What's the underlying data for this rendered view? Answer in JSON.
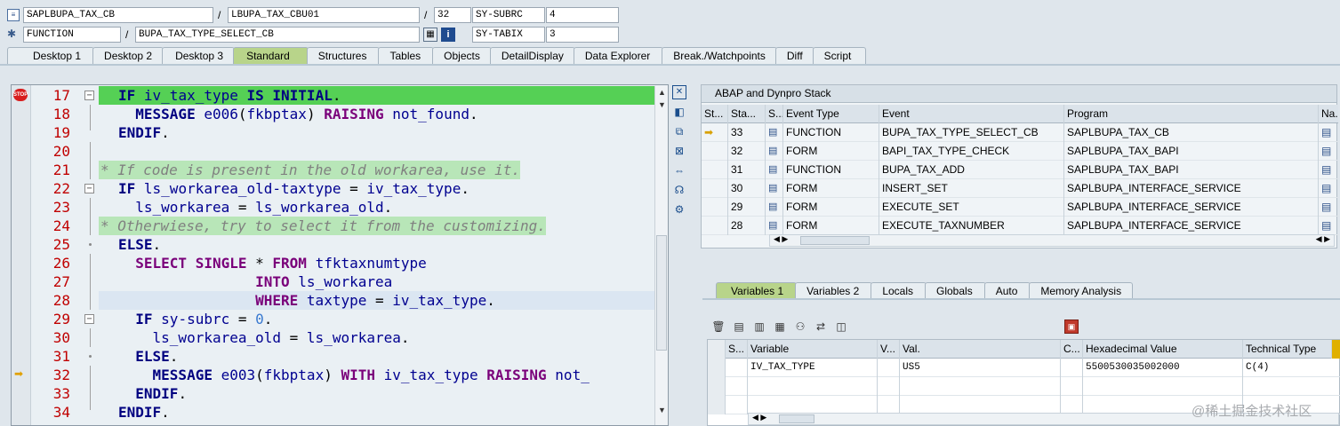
{
  "header": {
    "program": "SAPLBUPA_TAX_CB",
    "include": "LBUPA_TAX_CBU01",
    "line": "32",
    "sysvar1": "SY-SUBRC",
    "sysval1": "4",
    "event_type": "FUNCTION",
    "event": "BUPA_TAX_TYPE_SELECT_CB",
    "sysvar2": "SY-TABIX",
    "sysval2": "3"
  },
  "tabs": [
    "Desktop 1",
    "Desktop 2",
    "Desktop 3",
    "Standard",
    "Structures",
    "Tables",
    "Objects",
    "DetailDisplay",
    "Data Explorer",
    "Break./Watchpoints",
    "Diff",
    "Script"
  ],
  "editor": {
    "line_numbers": [
      "17",
      "18",
      "19",
      "20",
      "21",
      "22",
      "23",
      "24",
      "25",
      "26",
      "27",
      "28",
      "29",
      "30",
      "31",
      "32",
      "33",
      "34"
    ],
    "lines": [
      {
        "parts": [
          {
            "t": "IF ",
            "c": "kw"
          },
          {
            "t": "iv_tax_type ",
            "c": "id"
          },
          {
            "t": "IS INITIAL",
            "c": "kw"
          },
          {
            "t": ".",
            "c": ""
          }
        ]
      },
      {
        "parts": [
          {
            "t": "  MESSAGE ",
            "c": "kw"
          },
          {
            "t": "e006",
            "c": "id"
          },
          {
            "t": "(",
            "c": ""
          },
          {
            "t": "fkbptax",
            "c": "id"
          },
          {
            "t": ") ",
            "c": ""
          },
          {
            "t": "RAISING ",
            "c": "kw2"
          },
          {
            "t": "not_found",
            "c": "id"
          },
          {
            "t": ".",
            "c": ""
          }
        ]
      },
      {
        "parts": [
          {
            "t": "ENDIF",
            "c": "kw"
          },
          {
            "t": ".",
            "c": ""
          }
        ]
      },
      {
        "parts": []
      },
      {
        "parts": [
          {
            "t": "* If code is present in the old workarea, use it.",
            "c": "cmt"
          }
        ]
      },
      {
        "parts": [
          {
            "t": "IF ",
            "c": "kw"
          },
          {
            "t": "ls_workarea_old-taxtype ",
            "c": "id"
          },
          {
            "t": "= ",
            "c": ""
          },
          {
            "t": "iv_tax_type",
            "c": "id"
          },
          {
            "t": ".",
            "c": ""
          }
        ]
      },
      {
        "parts": [
          {
            "t": "  ls_workarea ",
            "c": "id"
          },
          {
            "t": "= ",
            "c": ""
          },
          {
            "t": "ls_workarea_old",
            "c": "id"
          },
          {
            "t": ".",
            "c": ""
          }
        ]
      },
      {
        "parts": [
          {
            "t": "* Otherwiese, try to select it from the customizing.",
            "c": "cmt"
          }
        ]
      },
      {
        "parts": [
          {
            "t": "ELSE",
            "c": "kw"
          },
          {
            "t": ".",
            "c": ""
          }
        ]
      },
      {
        "parts": [
          {
            "t": "  SELECT SINGLE ",
            "c": "kw2"
          },
          {
            "t": "* ",
            "c": ""
          },
          {
            "t": "FROM ",
            "c": "kw2"
          },
          {
            "t": "tfktaxnumtype",
            "c": "id"
          }
        ]
      },
      {
        "parts": [
          {
            "t": "                INTO ",
            "c": "kw2"
          },
          {
            "t": "ls_workarea",
            "c": "id"
          }
        ]
      },
      {
        "parts": [
          {
            "t": "                WHERE ",
            "c": "kw2"
          },
          {
            "t": "taxtype ",
            "c": "id"
          },
          {
            "t": "= ",
            "c": ""
          },
          {
            "t": "iv_tax_type",
            "c": "id"
          },
          {
            "t": ".",
            "c": ""
          }
        ]
      },
      {
        "parts": [
          {
            "t": "  IF ",
            "c": "kw"
          },
          {
            "t": "sy-subrc ",
            "c": "id"
          },
          {
            "t": "= ",
            "c": ""
          },
          {
            "t": "0",
            "c": "num"
          },
          {
            "t": ".",
            "c": ""
          }
        ]
      },
      {
        "parts": [
          {
            "t": "    ls_workarea_old ",
            "c": "id"
          },
          {
            "t": "= ",
            "c": ""
          },
          {
            "t": "ls_workarea",
            "c": "id"
          },
          {
            "t": ".",
            "c": ""
          }
        ]
      },
      {
        "parts": [
          {
            "t": "  ELSE",
            "c": "kw"
          },
          {
            "t": ".",
            "c": ""
          }
        ]
      },
      {
        "parts": [
          {
            "t": "    MESSAGE ",
            "c": "kw"
          },
          {
            "t": "e003",
            "c": "id"
          },
          {
            "t": "(",
            "c": ""
          },
          {
            "t": "fkbptax",
            "c": "id"
          },
          {
            "t": ") ",
            "c": ""
          },
          {
            "t": "WITH ",
            "c": "kw2"
          },
          {
            "t": "iv_tax_type ",
            "c": "id"
          },
          {
            "t": "RAISING ",
            "c": "kw2"
          },
          {
            "t": "not_",
            "c": "id"
          }
        ]
      },
      {
        "parts": [
          {
            "t": "  ENDIF",
            "c": "kw"
          },
          {
            "t": ".",
            "c": ""
          }
        ]
      },
      {
        "parts": [
          {
            "t": "ENDIF",
            "c": "kw"
          },
          {
            "t": ".",
            "c": ""
          }
        ]
      }
    ]
  },
  "stack": {
    "title": "ABAP and Dynpro Stack",
    "columns": [
      "St...",
      "Sta...",
      "S...",
      "Event Type",
      "Event",
      "Program",
      "Na..."
    ],
    "rows": [
      {
        "level": "33",
        "type": "FUNCTION",
        "event": "BUPA_TAX_TYPE_SELECT_CB",
        "program": "SAPLBUPA_TAX_CB",
        "current": true
      },
      {
        "level": "32",
        "type": "FORM",
        "event": "BAPI_TAX_TYPE_CHECK",
        "program": "SAPLBUPA_TAX_BAPI",
        "current": false
      },
      {
        "level": "31",
        "type": "FUNCTION",
        "event": "BUPA_TAX_ADD",
        "program": "SAPLBUPA_TAX_BAPI",
        "current": false
      },
      {
        "level": "30",
        "type": "FORM",
        "event": "INSERT_SET",
        "program": "SAPLBUPA_INTERFACE_SERVICE",
        "current": false
      },
      {
        "level": "29",
        "type": "FORM",
        "event": "EXECUTE_SET",
        "program": "SAPLBUPA_INTERFACE_SERVICE",
        "current": false
      },
      {
        "level": "28",
        "type": "FORM",
        "event": "EXECUTE_TAXNUMBER",
        "program": "SAPLBUPA_INTERFACE_SERVICE",
        "current": false
      }
    ]
  },
  "var_tabs": [
    "Variables 1",
    "Variables 2",
    "Locals",
    "Globals",
    "Auto",
    "Memory Analysis"
  ],
  "vars": {
    "columns": [
      "S...",
      "Variable",
      "V...",
      "Val.",
      "C...",
      "Hexadecimal Value",
      "Technical Type"
    ],
    "rows": [
      {
        "variable": "IV_TAX_TYPE",
        "value": "US5",
        "hex": "5500530035002000",
        "type": "C(4)"
      }
    ]
  },
  "watermark": "@稀土掘金技术社区"
}
